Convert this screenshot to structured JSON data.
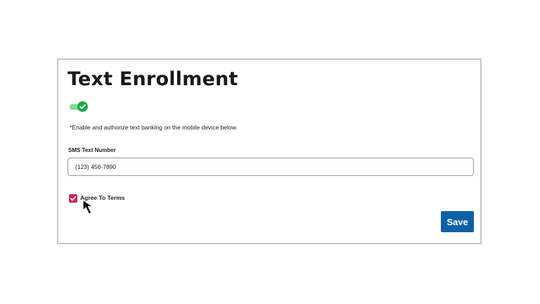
{
  "form": {
    "title": "Text Enrollment",
    "toggle_state": "on",
    "toggle_icon": "check-icon",
    "note": "*Enable and authorize text banking on the mobile device below.",
    "sms_label": "SMS Text Number",
    "sms_value": "(123) 456-7890",
    "agree_checked": true,
    "agree_label": "Agree To Terms",
    "save_label": "Save"
  },
  "colors": {
    "toggle_track": "#7fd99a",
    "toggle_knob": "#1fa84a",
    "checkbox": "#c6295a",
    "save_button": "#0f5fa6",
    "card_border": "#c8c8c8"
  },
  "cursor": {
    "icon": "mouse-pointer-icon"
  }
}
